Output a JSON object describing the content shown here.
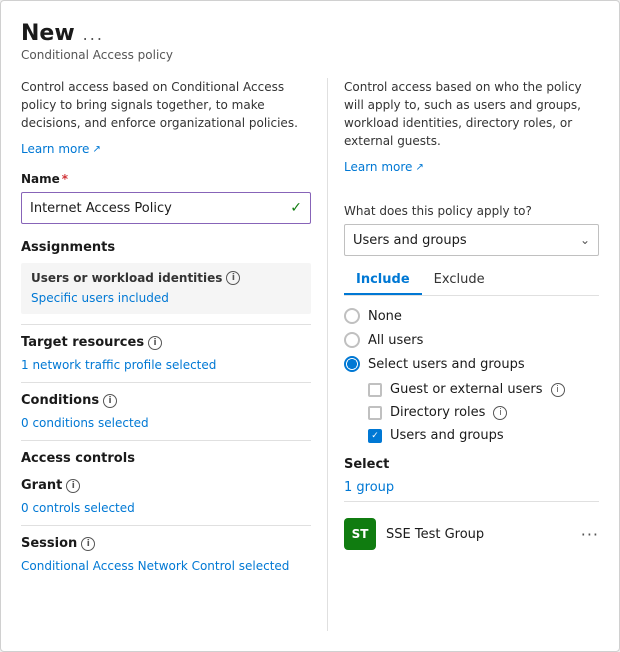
{
  "header": {
    "title": "New",
    "dots": "...",
    "subtitle": "Conditional Access policy"
  },
  "left_panel": {
    "description": "Control access based on Conditional Access policy to bring signals together, to make decisions, and enforce organizational policies.",
    "learn_more": "Learn more",
    "name_label": "Name",
    "name_value": "Internet Access Policy",
    "assignments_label": "Assignments",
    "users_section": {
      "label": "Users or workload identities",
      "sublabel": "Specific users included"
    },
    "target_resources": {
      "label": "Target resources",
      "link": "1 network traffic profile selected"
    },
    "conditions": {
      "label": "Conditions",
      "link": "0 conditions selected"
    },
    "access_controls": {
      "label": "Access controls"
    },
    "grant": {
      "label": "Grant",
      "link": "0 controls selected"
    },
    "session": {
      "label": "Session",
      "link": "Conditional Access Network Control selected"
    }
  },
  "right_panel": {
    "description": "Control access based on who the policy will apply to, such as users and groups, workload identities, directory roles, or external guests.",
    "learn_more": "Learn more",
    "policy_question": "What does this policy apply to?",
    "dropdown_value": "Users and groups",
    "tabs": [
      {
        "label": "Include",
        "active": true
      },
      {
        "label": "Exclude",
        "active": false
      }
    ],
    "radio_options": [
      {
        "label": "None",
        "selected": false
      },
      {
        "label": "All users",
        "selected": false
      },
      {
        "label": "Select users and groups",
        "selected": true
      }
    ],
    "checkboxes": [
      {
        "label": "Guest or external users",
        "checked": false,
        "has_info": true
      },
      {
        "label": "Directory roles",
        "checked": false,
        "has_info": true
      },
      {
        "label": "Users and groups",
        "checked": true,
        "has_info": false
      }
    ],
    "select_label": "Select",
    "group_link": "1 group",
    "group": {
      "initials": "ST",
      "name": "SSE Test Group",
      "more": "···"
    }
  }
}
